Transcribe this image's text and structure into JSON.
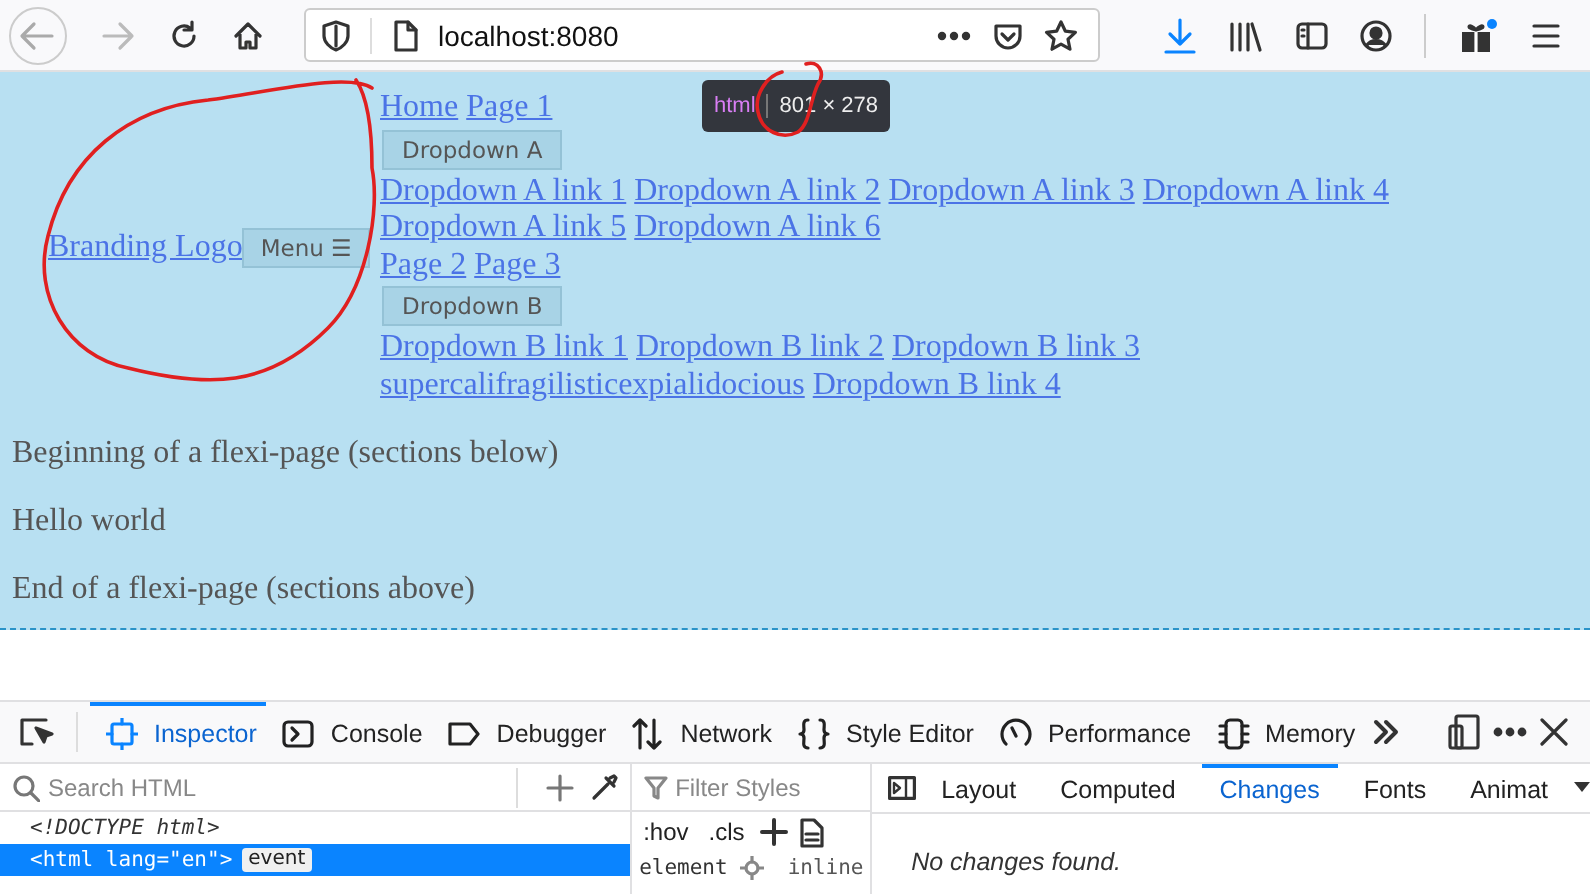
{
  "browser": {
    "url": "localhost:8080"
  },
  "page": {
    "logo": "Branding Logo",
    "menu_button": "Menu ☰",
    "nav": [
      {
        "kind": "links",
        "items": [
          "Home",
          "Page 1"
        ]
      },
      {
        "kind": "dropdown",
        "label": "Dropdown A",
        "items": [
          "Dropdown A link 1",
          "Dropdown A link 2",
          "Dropdown A link 3",
          "Dropdown A link 4",
          "Dropdown A link 5",
          "Dropdown A link 6"
        ]
      },
      {
        "kind": "links",
        "items": [
          "Page 2",
          "Page 3"
        ]
      },
      {
        "kind": "dropdown",
        "label": "Dropdown B",
        "items": [
          "Dropdown B link 1",
          "Dropdown B link 2",
          "Dropdown B link 3",
          "supercalifragilisticexpialidocious",
          "Dropdown B link 4"
        ]
      }
    ],
    "paragraphs": [
      "Beginning of a flexi-page (sections below)",
      "Hello world",
      "End of a flexi-page (sections above)"
    ]
  },
  "tooltip": {
    "tag": "html",
    "size": "801 × 278"
  },
  "devtools": {
    "tabs": [
      {
        "label": "Inspector",
        "selected": true
      },
      {
        "label": "Console",
        "selected": false
      },
      {
        "label": "Debugger",
        "selected": false
      },
      {
        "label": "Network",
        "selected": false
      },
      {
        "label": "Style Editor",
        "selected": false
      },
      {
        "label": "Performance",
        "selected": false
      },
      {
        "label": "Memory",
        "selected": false
      }
    ],
    "search": {
      "placeholder": "Search HTML"
    },
    "tree": [
      {
        "kind": "doctype",
        "text": "<!DOCTYPE html>",
        "selected": false
      },
      {
        "kind": "element",
        "text": "<html lang=\"en\">",
        "badge": "event",
        "selected": true
      }
    ],
    "styles": {
      "placeholder": "Filter Styles",
      "hov": ":hov",
      "cls": ".cls",
      "element": "element",
      "inline": "inline"
    },
    "sidebar_tabs": [
      {
        "label": "Layout",
        "selected": false
      },
      {
        "label": "Computed",
        "selected": false
      },
      {
        "label": "Changes",
        "selected": true
      },
      {
        "label": "Fonts",
        "selected": false
      },
      {
        "label": "Animat",
        "selected": false
      }
    ],
    "message": "No changes found."
  }
}
